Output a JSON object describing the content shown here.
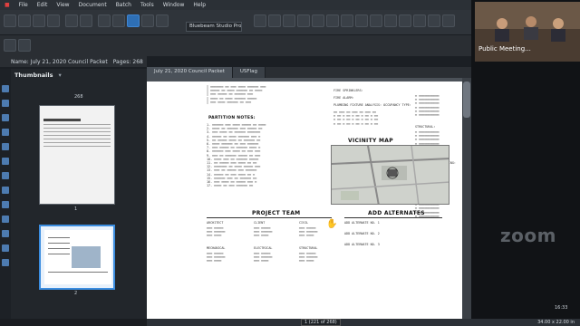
{
  "menu": [
    "File",
    "Edit",
    "View",
    "Document",
    "Batch",
    "Tools",
    "Window",
    "Help"
  ],
  "toolbar": {
    "profile_label": "Bluebeam Studio Prom"
  },
  "infobar": {
    "name_label": "Name:",
    "name_value": "July 21, 2020 Council Packet",
    "pages_label": "Pages:",
    "pages_value": "268"
  },
  "tabs": [
    {
      "label": "July 21, 2020 Council Packet"
    },
    {
      "label": "USFlag"
    }
  ],
  "thumbnails": {
    "title": "Thumbnails",
    "page_number_top": "268",
    "items": [
      {
        "label": "1"
      },
      {
        "label": "2"
      }
    ]
  },
  "sheet": {
    "partition_notes_title": "PARTITION NOTES:",
    "vicinity_map_title": "VICINITY MAP",
    "project_team_title": "PROJECT TEAM",
    "add_alternates_title": "ADD ALTERNATES",
    "fire_sprinklers": "FIRE SPRINKLERS:",
    "fire_alarm": "FIRE ALARM:",
    "plumbing_fixture": "PLUMBING FIXTURE ANALYSIS:  OCCUPANCY TYPE:",
    "team_roles": [
      "ARCHITECT",
      "CLIENT",
      "CIVIL",
      "MECHANICAL",
      "STRUCTURAL",
      "ELECTRICAL"
    ],
    "add_alternates": [
      "ADD ALTERNATE NO. 1",
      "ADD ALTERNATE NO. 2",
      "ADD ALTERNATE NO. 3"
    ],
    "schedule_sections": [
      "STRUCTURAL:",
      "MECHANICAL - PLUMBING:",
      "ELECTRICAL:"
    ]
  },
  "statusbar": {
    "page_indicator": "1 (221 of 268)",
    "paper_size": "34.00 x 22.00 in",
    "scale_label": "No Scale"
  },
  "zoom": {
    "participant_label": "Public Meeting...",
    "watermark": "zoom",
    "time": "16:33"
  }
}
